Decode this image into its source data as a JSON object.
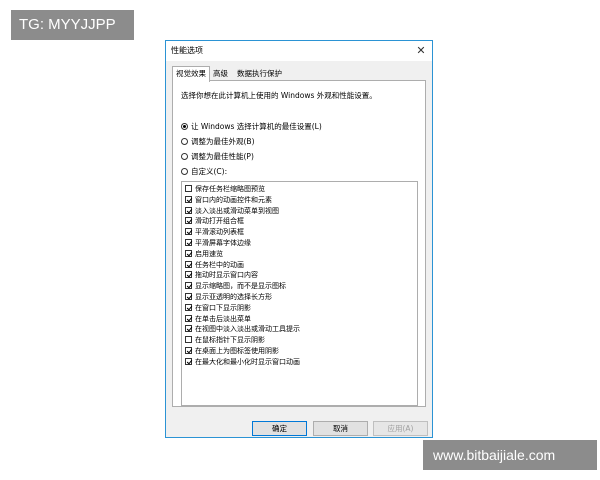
{
  "watermarks": {
    "top_left": "TG: MYYJJPP",
    "bottom_right": "www.bitbaijiale.com"
  },
  "dialog": {
    "title": "性能选项",
    "close_icon": "close-icon",
    "tabs": [
      {
        "label": "视觉效果",
        "active": true
      },
      {
        "label": "高级",
        "active": false
      },
      {
        "label": "数据执行保护",
        "active": false
      }
    ],
    "description": "选择你想在此计算机上使用的 Windows 外观和性能设置。",
    "radios": [
      {
        "label": "让 Windows 选择计算机的最佳设置(L)",
        "selected": true
      },
      {
        "label": "调整为最佳外观(B)",
        "selected": false
      },
      {
        "label": "调整为最佳性能(P)",
        "selected": false
      },
      {
        "label": "自定义(C):",
        "selected": false
      }
    ],
    "options": [
      {
        "label": "保存任务栏缩略图预览",
        "checked": false
      },
      {
        "label": "窗口内的动画控件和元素",
        "checked": true
      },
      {
        "label": "淡入淡出或滑动菜单到视图",
        "checked": true
      },
      {
        "label": "滑动打开组合框",
        "checked": true
      },
      {
        "label": "平滑滚动列表框",
        "checked": true
      },
      {
        "label": "平滑屏幕字体边缘",
        "checked": true
      },
      {
        "label": "启用速览",
        "checked": true
      },
      {
        "label": "任务栏中的动画",
        "checked": true
      },
      {
        "label": "拖动时显示窗口内容",
        "checked": true
      },
      {
        "label": "显示缩略图，而不是显示图标",
        "checked": true
      },
      {
        "label": "显示亚透明的选择长方形",
        "checked": true
      },
      {
        "label": "在窗口下显示阴影",
        "checked": true
      },
      {
        "label": "在单击后淡出菜单",
        "checked": true
      },
      {
        "label": "在视图中淡入淡出或滑动工具提示",
        "checked": true
      },
      {
        "label": "在鼠标指针下显示阴影",
        "checked": false
      },
      {
        "label": "在桌面上为图标签使用阴影",
        "checked": true
      },
      {
        "label": "在最大化和最小化时显示窗口动画",
        "checked": true
      }
    ],
    "buttons": {
      "ok": "确定",
      "cancel": "取消",
      "apply": "应用(A)"
    },
    "colors": {
      "border_accent": "#2b93d4",
      "default_button_border": "#0078d7"
    }
  }
}
